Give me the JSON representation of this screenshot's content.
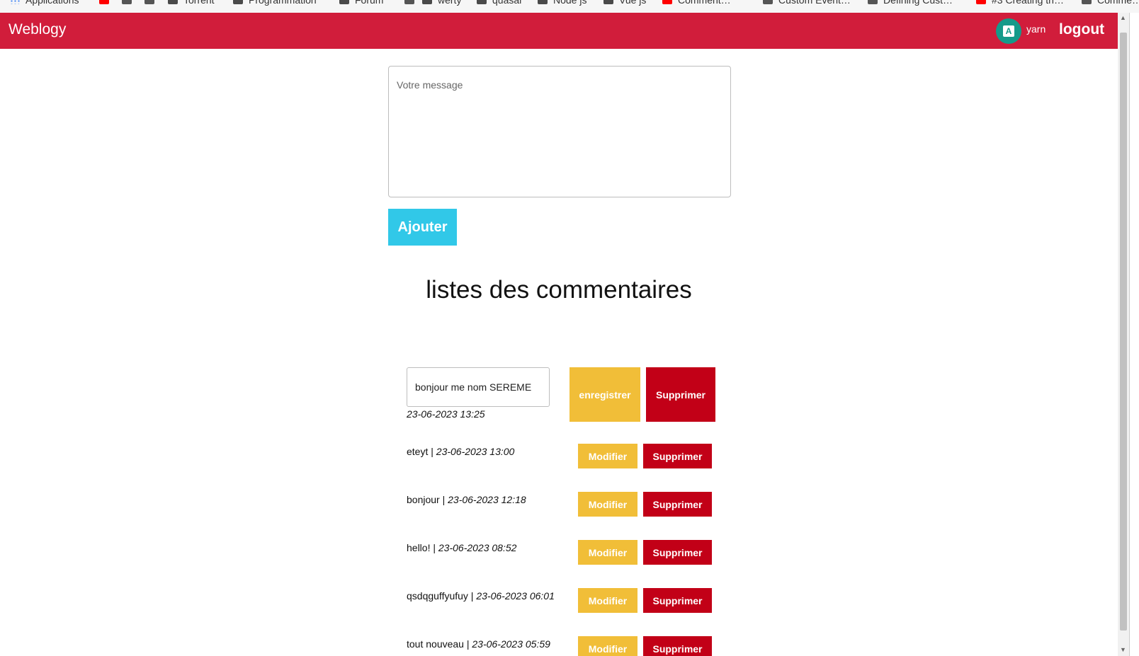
{
  "bookmarks": [
    {
      "label": "Applications",
      "icon": "grid-icon"
    },
    {
      "label": "",
      "icon": "youtube-icon"
    },
    {
      "label": "",
      "icon": "translate-icon"
    },
    {
      "label": "",
      "icon": "github-icon"
    },
    {
      "label": "Torrent",
      "icon": "folder-icon"
    },
    {
      "label": "Programmation",
      "icon": "folder-icon"
    },
    {
      "label": "Forum",
      "icon": "folder-icon"
    },
    {
      "label": "",
      "icon": "gear-icon"
    },
    {
      "label": "werty",
      "icon": "folder-icon"
    },
    {
      "label": "quasar",
      "icon": "folder-icon"
    },
    {
      "label": "Node js",
      "icon": "folder-icon"
    },
    {
      "label": "Vue js",
      "icon": "folder-icon"
    },
    {
      "label": "Comment…",
      "icon": "youtube-icon"
    },
    {
      "label": "Custom Event…",
      "icon": "vue-icon"
    },
    {
      "label": "Defining Cust…",
      "icon": "site-icon"
    },
    {
      "label": "#3 Creating th…",
      "icon": "youtube-icon"
    },
    {
      "label": "Comme…",
      "icon": "site-icon"
    }
  ],
  "header": {
    "brand": "Weblogy",
    "avatar_letter": "A",
    "username": "yarn",
    "logout": "logout",
    "color": "#d11d3b"
  },
  "form": {
    "placeholder": "Votre message",
    "submit_label": "Ajouter"
  },
  "list": {
    "title": "listes des commentaires"
  },
  "editing": {
    "value": "bonjour me nom SEREME",
    "date": "23-06-2023 13:25",
    "save_label": "enregistrer",
    "delete_label": "Supprimer"
  },
  "comments": [
    {
      "text": "eteyt",
      "date": "23-06-2023 13:00",
      "edit_label": "Modifier",
      "delete_label": "Supprimer"
    },
    {
      "text": "bonjour",
      "date": "23-06-2023 12:18",
      "edit_label": "Modifier",
      "delete_label": "Supprimer"
    },
    {
      "text": "hello!",
      "date": "23-06-2023 08:52",
      "edit_label": "Modifier",
      "delete_label": "Supprimer"
    },
    {
      "text": "qsdqguffyufuy",
      "date": "23-06-2023 06:01",
      "edit_label": "Modifier",
      "delete_label": "Supprimer"
    },
    {
      "text": "tout nouveau",
      "date": "23-06-2023 05:59",
      "edit_label": "Modifier",
      "delete_label": "Supprimer"
    }
  ],
  "colors": {
    "accent_cyan": "#31c8e8",
    "warning_yellow": "#f1be38",
    "danger_red": "#c20017"
  }
}
